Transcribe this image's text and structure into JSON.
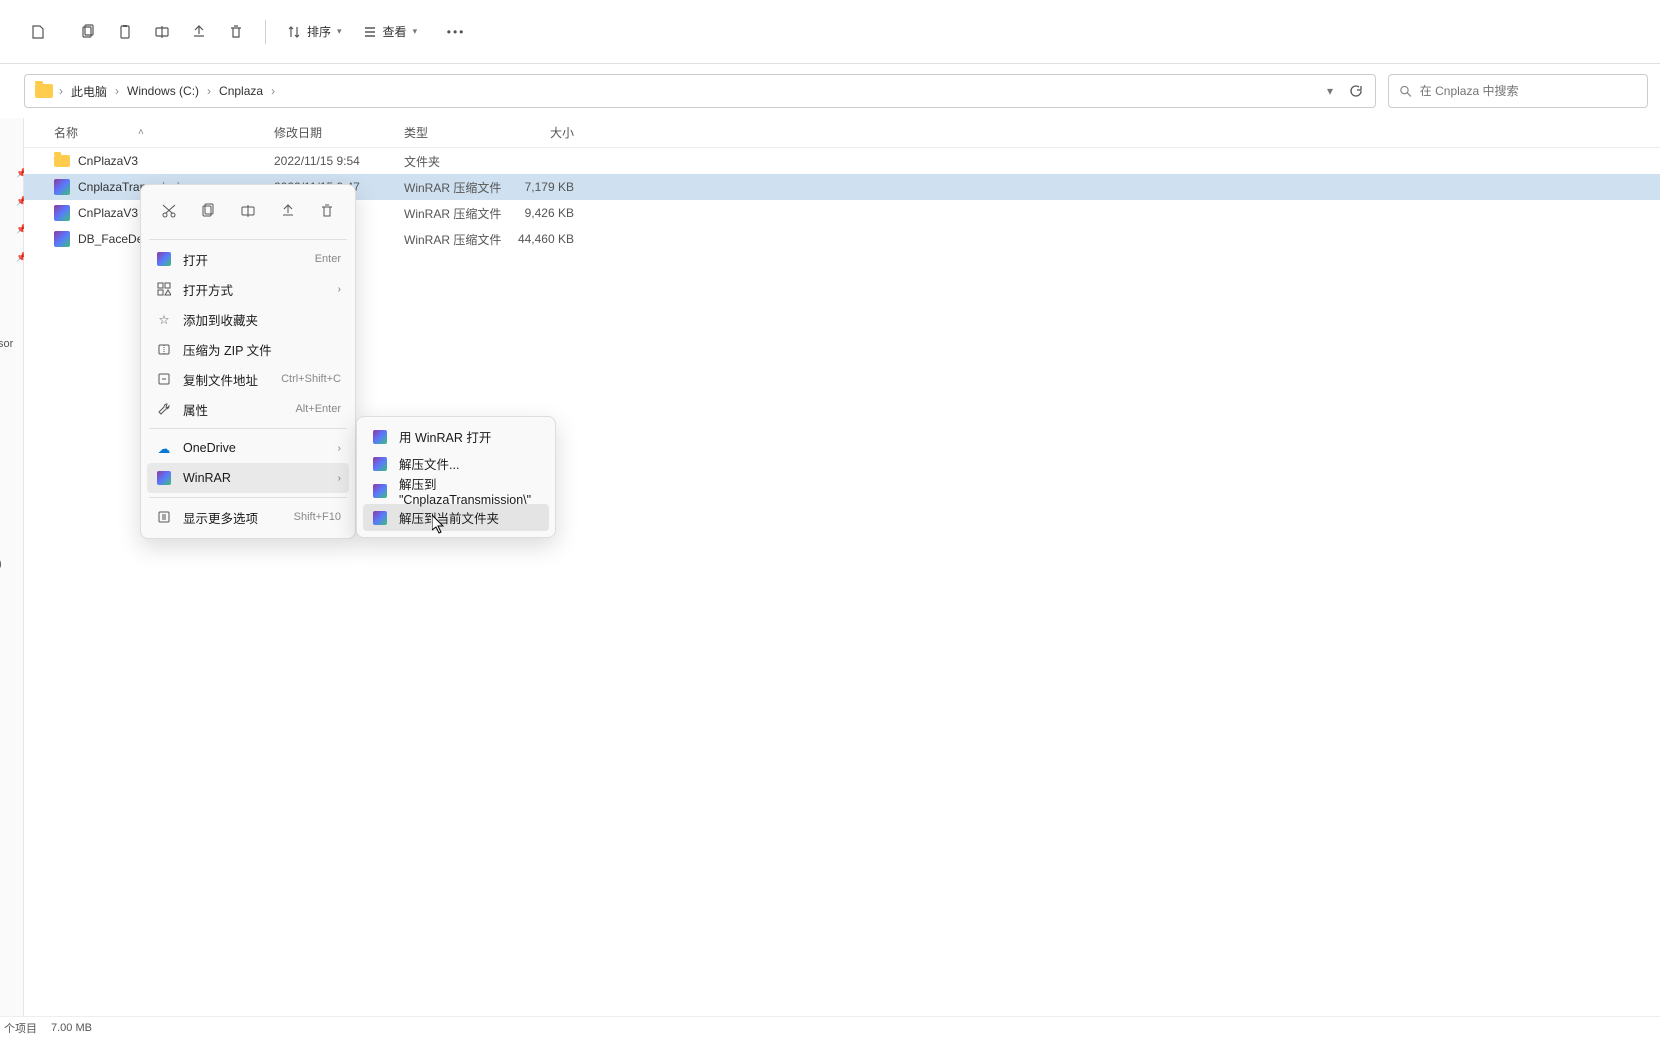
{
  "toolbar": {
    "sort_label": "排序",
    "view_label": "查看"
  },
  "breadcrumb": {
    "root": "此电脑",
    "drive": "Windows (C:)",
    "folder": "Cnplaza"
  },
  "search": {
    "placeholder": "在 Cnplaza 中搜索"
  },
  "columns": {
    "name": "名称",
    "date": "修改日期",
    "type": "类型",
    "size": "大小"
  },
  "rows": [
    {
      "name": "CnPlazaV3",
      "date": "2022/11/15 9:54",
      "type": "文件夹",
      "size": ""
    },
    {
      "name": "CnplazaTransmission",
      "date": "2022/11/15 9:47",
      "type": "WinRAR 压缩文件",
      "size": "7,179 KB"
    },
    {
      "name": "CnPlazaV3",
      "date": "",
      "type": "WinRAR 压缩文件",
      "size": "9,426 KB"
    },
    {
      "name": "DB_FaceDetect",
      "date": "",
      "type": "WinRAR 压缩文件",
      "size": "44,460 KB"
    }
  ],
  "ctx": {
    "open": "打开",
    "open_key": "Enter",
    "open_with": "打开方式",
    "add_fav": "添加到收藏夹",
    "zip": "压缩为 ZIP 文件",
    "copy_path": "复制文件地址",
    "copy_path_key": "Ctrl+Shift+C",
    "props": "属性",
    "props_key": "Alt+Enter",
    "onedrive": "OneDrive",
    "winrar": "WinRAR",
    "more": "显示更多选项",
    "more_key": "Shift+F10"
  },
  "submenu": {
    "open_rar": "用 WinRAR 打开",
    "extract": "解压文件...",
    "extract_to": "解压到 \"CnplazaTransmission\\\"",
    "extract_here": "解压到当前文件夹"
  },
  "sidebar": {
    "truncated1": "sor",
    "truncated2": ")"
  },
  "status": {
    "item": "个项目",
    "size": "7.00 MB"
  }
}
